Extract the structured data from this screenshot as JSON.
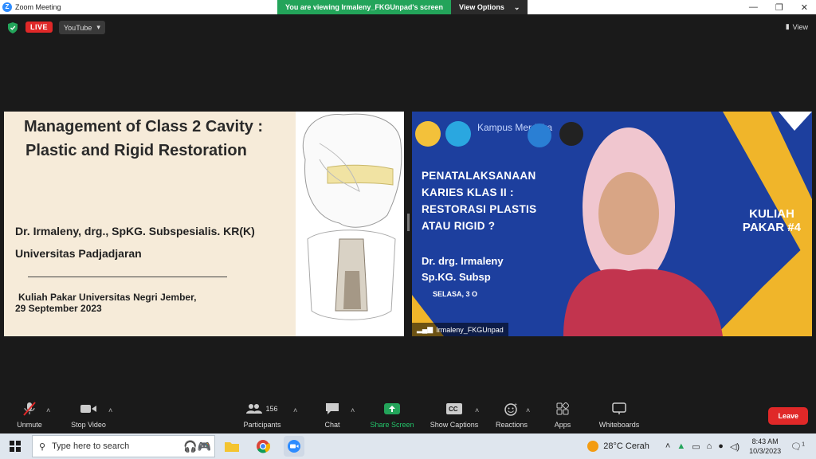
{
  "app": {
    "title": "Zoom Meeting"
  },
  "banner": {
    "message": "You are viewing Irmaleny_FKGUnpad's screen",
    "options_label": "View Options"
  },
  "status": {
    "live": "LIVE",
    "stream_service": "YouTube",
    "view_label": "View"
  },
  "slide": {
    "title_line1": "Management of Class 2 Cavity :",
    "title_line2": "Plastic and Rigid Restoration",
    "author": "Dr. Irmaleny, drg., SpKG. Subspesialis. KR(K)",
    "university": "Universitas Padjadjaran",
    "event_line1": "Kuliah Pakar Universitas Negri Jember,",
    "event_line2": "29 September 2023"
  },
  "video": {
    "logo_text": "Kampus Merdeka",
    "headline": [
      "PENATALAKSANAAN",
      "KARIES KLAS II :",
      "RESTORASI PLASTIS",
      "ATAU RIGID ?"
    ],
    "badge_line1": "KULIAH",
    "badge_line2": "PAKAR #4",
    "speaker_line1": "Dr.  drg.  Irmaleny",
    "speaker_line2": "Sp.KG. Subsp",
    "date_partial": "SELASA, 3 O",
    "participant_name": "Irmaleny_FKGUnpad"
  },
  "toolbar": {
    "unmute": "Unmute",
    "stop_video": "Stop Video",
    "participants": "Participants",
    "participants_count": "156",
    "chat": "Chat",
    "share_screen": "Share Screen",
    "show_captions": "Show Captions",
    "reactions": "Reactions",
    "apps": "Apps",
    "whiteboards": "Whiteboards",
    "leave": "Leave"
  },
  "taskbar": {
    "search_placeholder": "Type here to search",
    "weather": "28°C  Cerah",
    "time": "8:43 AM",
    "date": "10/3/2023",
    "notification_count": "1"
  },
  "colors": {
    "accent_green": "#23a45a",
    "leave_red": "#e02828",
    "video_blue": "#1d3f9e",
    "slide_bg": "#f6ebd9"
  }
}
